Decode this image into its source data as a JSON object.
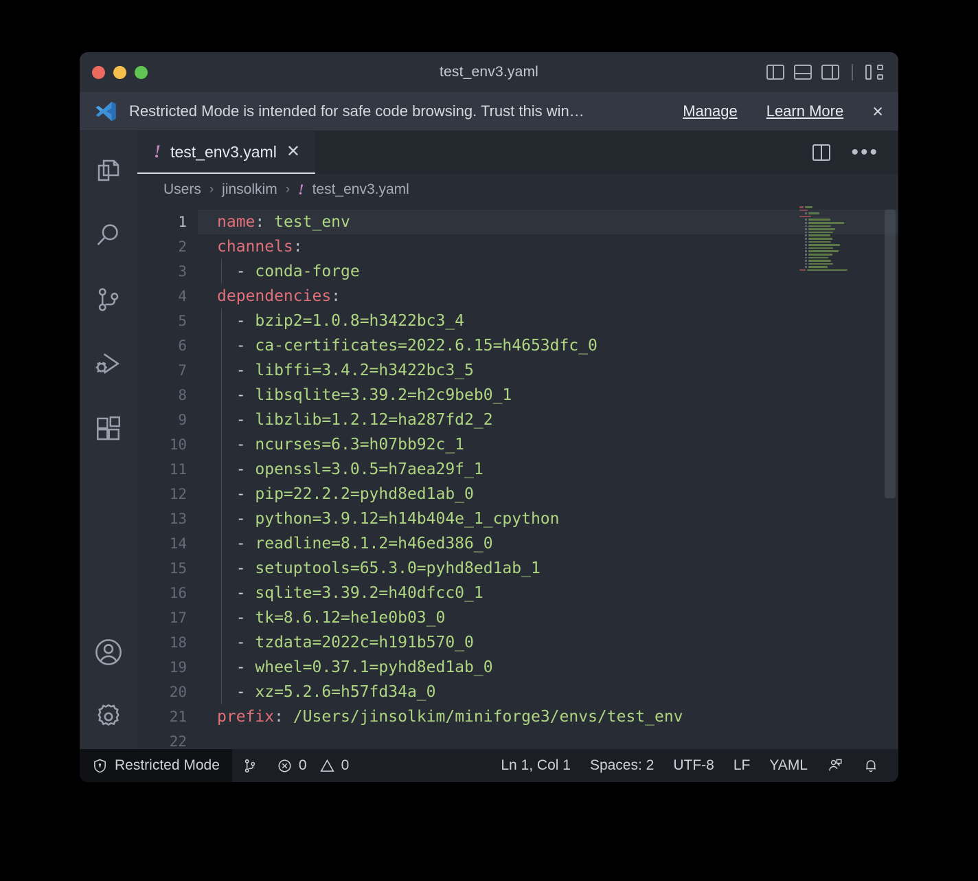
{
  "window": {
    "title": "test_env3.yaml",
    "traffic_lights": [
      "close-red",
      "minimize-yellow",
      "maximize-green"
    ],
    "title_actions": [
      {
        "name": "toggle-primary-sidebar",
        "icon": "layout-sidebar-left-icon"
      },
      {
        "name": "toggle-panel",
        "icon": "layout-panel-icon"
      },
      {
        "name": "toggle-secondary-sidebar",
        "icon": "layout-sidebar-right-icon"
      },
      {
        "name": "customize-layout",
        "icon": "customize-layout-icon"
      }
    ]
  },
  "banner": {
    "icon": "vscode-logo-icon",
    "message": "Restricted Mode is intended for safe code browsing. Trust this win…",
    "manage_label": "Manage",
    "learn_more_label": "Learn More",
    "close_label": "×"
  },
  "activitybar": {
    "items": [
      {
        "name": "sidebar-item-explorer",
        "icon": "files-icon"
      },
      {
        "name": "sidebar-item-search",
        "icon": "search-icon"
      },
      {
        "name": "sidebar-item-source-control",
        "icon": "source-control-icon"
      },
      {
        "name": "sidebar-item-run-debug",
        "icon": "run-and-debug-icon"
      },
      {
        "name": "sidebar-item-extensions",
        "icon": "extensions-icon"
      }
    ],
    "bottom_items": [
      {
        "name": "sidebar-item-accounts",
        "icon": "account-icon"
      },
      {
        "name": "sidebar-item-settings",
        "icon": "gear-icon"
      }
    ]
  },
  "tabs": [
    {
      "warning_glyph": "!",
      "label": "test_env3.yaml",
      "close_glyph": "✕",
      "active": true
    }
  ],
  "editor_actions": [
    {
      "name": "split-editor-right-button",
      "icon": "split-editor-icon"
    },
    {
      "name": "more-actions-button",
      "icon": "ellipsis-icon",
      "glyph": "•••"
    }
  ],
  "breadcrumbs": {
    "separator": "›",
    "items": [
      {
        "label": "Users",
        "warn": false
      },
      {
        "label": "jinsolkim",
        "warn": false
      },
      {
        "label": "test_env3.yaml",
        "warn": true,
        "warn_glyph": "!"
      }
    ]
  },
  "code": {
    "language": "yaml",
    "active_line": 1,
    "lines": [
      {
        "n": 1,
        "indent": false,
        "key": "name",
        "colon": ":",
        "value": " test_env"
      },
      {
        "n": 2,
        "indent": false,
        "key": "channels",
        "colon": ":",
        "value": ""
      },
      {
        "n": 3,
        "indent": true,
        "dash": "  - ",
        "value": "conda-forge"
      },
      {
        "n": 4,
        "indent": false,
        "key": "dependencies",
        "colon": ":",
        "value": ""
      },
      {
        "n": 5,
        "indent": true,
        "dash": "  - ",
        "value": "bzip2=1.0.8=h3422bc3_4"
      },
      {
        "n": 6,
        "indent": true,
        "dash": "  - ",
        "value": "ca-certificates=2022.6.15=h4653dfc_0"
      },
      {
        "n": 7,
        "indent": true,
        "dash": "  - ",
        "value": "libffi=3.4.2=h3422bc3_5"
      },
      {
        "n": 8,
        "indent": true,
        "dash": "  - ",
        "value": "libsqlite=3.39.2=h2c9beb0_1"
      },
      {
        "n": 9,
        "indent": true,
        "dash": "  - ",
        "value": "libzlib=1.2.12=ha287fd2_2"
      },
      {
        "n": 10,
        "indent": true,
        "dash": "  - ",
        "value": "ncurses=6.3=h07bb92c_1"
      },
      {
        "n": 11,
        "indent": true,
        "dash": "  - ",
        "value": "openssl=3.0.5=h7aea29f_1"
      },
      {
        "n": 12,
        "indent": true,
        "dash": "  - ",
        "value": "pip=22.2.2=pyhd8ed1ab_0"
      },
      {
        "n": 13,
        "indent": true,
        "dash": "  - ",
        "value": "python=3.9.12=h14b404e_1_cpython"
      },
      {
        "n": 14,
        "indent": true,
        "dash": "  - ",
        "value": "readline=8.1.2=h46ed386_0"
      },
      {
        "n": 15,
        "indent": true,
        "dash": "  - ",
        "value": "setuptools=65.3.0=pyhd8ed1ab_1"
      },
      {
        "n": 16,
        "indent": true,
        "dash": "  - ",
        "value": "sqlite=3.39.2=h40dfcc0_1"
      },
      {
        "n": 17,
        "indent": true,
        "dash": "  - ",
        "value": "tk=8.6.12=he1e0b03_0"
      },
      {
        "n": 18,
        "indent": true,
        "dash": "  - ",
        "value": "tzdata=2022c=h191b570_0"
      },
      {
        "n": 19,
        "indent": true,
        "dash": "  - ",
        "value": "wheel=0.37.1=pyhd8ed1ab_0"
      },
      {
        "n": 20,
        "indent": true,
        "dash": "  - ",
        "value": "xz=5.2.6=h57fd34a_0"
      },
      {
        "n": 21,
        "indent": false,
        "key": "prefix",
        "colon": ":",
        "value": " /Users/jinsolkim/miniforge3/envs/test_env"
      },
      {
        "n": 22,
        "indent": false,
        "value": ""
      }
    ]
  },
  "statusbar": {
    "restricted_mode": {
      "icon": "shield-lock-icon",
      "label": "Restricted Mode"
    },
    "source_control": {
      "icon": "source-control-icon",
      "label": ""
    },
    "problems": {
      "errors_icon": "error-circle-icon",
      "errors": "0",
      "warnings_icon": "warning-triangle-icon",
      "warnings": "0"
    },
    "cursor_position": "Ln 1, Col 1",
    "indentation": "Spaces: 2",
    "encoding": "UTF-8",
    "eol": "LF",
    "language_mode": "YAML",
    "live_share": {
      "icon": "live-share-icon"
    },
    "notifications": {
      "icon": "bell-icon"
    }
  },
  "colors": {
    "window_bg": "#252931",
    "titlebar_bg": "#2b2f38",
    "banner_bg": "#333842",
    "editor_bg": "#282c34",
    "activitybar_bg": "#2b2f38",
    "statusbar_bg": "#1b1e24",
    "key_color": "#e0707a",
    "value_color": "#aed581",
    "warn_color": "#c586c0",
    "accent_blue": "#3d8fd6"
  }
}
